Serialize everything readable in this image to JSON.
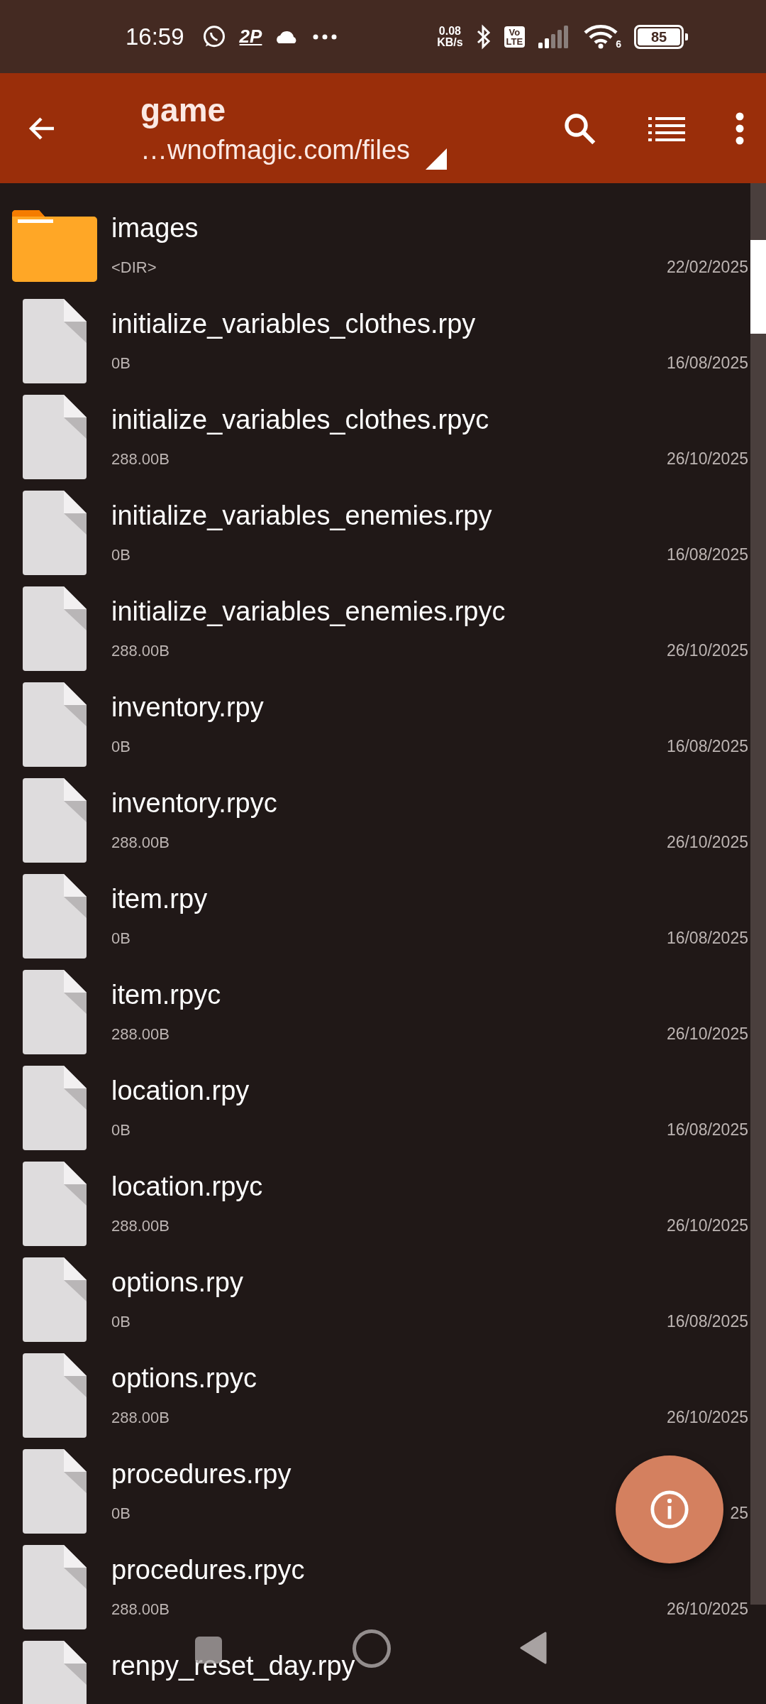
{
  "status_bar": {
    "time": "16:59",
    "app_badge": "2P",
    "net_speed": "0.08",
    "net_unit": "KB/s",
    "volte": [
      "Vo",
      "LTE"
    ],
    "wifi_label": "6",
    "battery": "85"
  },
  "toolbar": {
    "title": "game",
    "path": "…wnofmagic.com/files"
  },
  "files": [
    {
      "kind": "folder",
      "name": "images",
      "info": "<DIR>",
      "date": "22/02/2025"
    },
    {
      "kind": "file",
      "name": "initialize_variables_clothes.rpy",
      "info": "0B",
      "date": "16/08/2025"
    },
    {
      "kind": "file",
      "name": "initialize_variables_clothes.rpyc",
      "info": "288.00B",
      "date": "26/10/2025"
    },
    {
      "kind": "file",
      "name": "initialize_variables_enemies.rpy",
      "info": "0B",
      "date": "16/08/2025"
    },
    {
      "kind": "file",
      "name": "initialize_variables_enemies.rpyc",
      "info": "288.00B",
      "date": "26/10/2025"
    },
    {
      "kind": "file",
      "name": "inventory.rpy",
      "info": "0B",
      "date": "16/08/2025"
    },
    {
      "kind": "file",
      "name": "inventory.rpyc",
      "info": "288.00B",
      "date": "26/10/2025"
    },
    {
      "kind": "file",
      "name": "item.rpy",
      "info": "0B",
      "date": "16/08/2025"
    },
    {
      "kind": "file",
      "name": "item.rpyc",
      "info": "288.00B",
      "date": "26/10/2025"
    },
    {
      "kind": "file",
      "name": "location.rpy",
      "info": "0B",
      "date": "16/08/2025"
    },
    {
      "kind": "file",
      "name": "location.rpyc",
      "info": "288.00B",
      "date": "26/10/2025"
    },
    {
      "kind": "file",
      "name": "options.rpy",
      "info": "0B",
      "date": "16/08/2025"
    },
    {
      "kind": "file",
      "name": "options.rpyc",
      "info": "288.00B",
      "date": "26/10/2025"
    },
    {
      "kind": "file",
      "name": "procedures.rpy",
      "info": "0B",
      "date": "25"
    },
    {
      "kind": "file",
      "name": "procedures.rpyc",
      "info": "288.00B",
      "date": "26/10/2025"
    },
    {
      "kind": "file",
      "name": "renpy_reset_day.rpy"
    }
  ]
}
